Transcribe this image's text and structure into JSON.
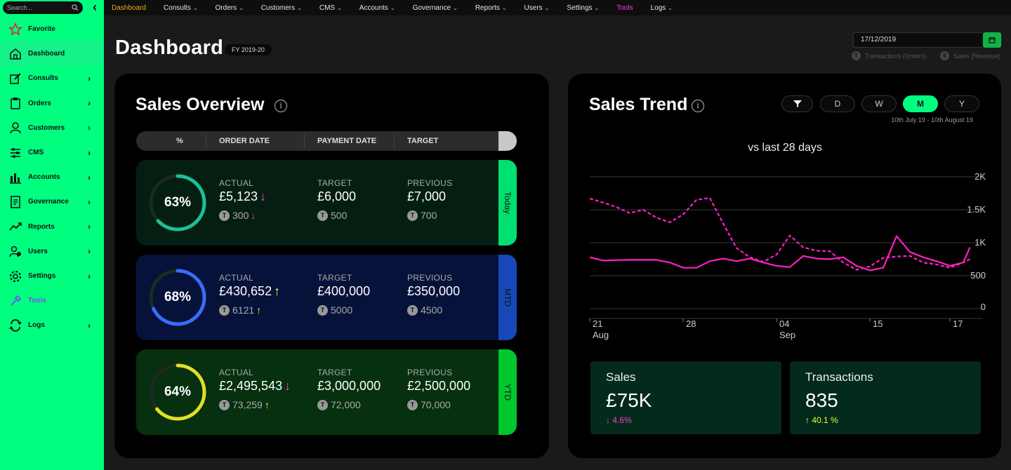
{
  "sidebar": {
    "search_placeholder": "Search...",
    "items": [
      {
        "label": "Favorite",
        "icon": "star-icon",
        "chevron": false
      },
      {
        "label": "Dashboard",
        "icon": "home-icon",
        "chevron": false
      },
      {
        "label": "Consults",
        "icon": "edit-icon",
        "chevron": true
      },
      {
        "label": "Orders",
        "icon": "clipboard-icon",
        "chevron": true
      },
      {
        "label": "Customers",
        "icon": "user-icon",
        "chevron": true
      },
      {
        "label": "CMS",
        "icon": "sliders-icon",
        "chevron": true
      },
      {
        "label": "Accounts",
        "icon": "bar-chart-icon",
        "chevron": true
      },
      {
        "label": "Governance",
        "icon": "document-icon",
        "chevron": true
      },
      {
        "label": "Reports",
        "icon": "trend-icon",
        "chevron": true
      },
      {
        "label": "Users",
        "icon": "users-icon",
        "chevron": true
      },
      {
        "label": "Settings",
        "icon": "gear-icon",
        "chevron": true
      },
      {
        "label": "Tools",
        "icon": "tools-icon",
        "chevron": false
      },
      {
        "label": "Logs",
        "icon": "sync-icon",
        "chevron": true
      }
    ]
  },
  "topnav": [
    {
      "label": "Dashboard",
      "dropdown": false
    },
    {
      "label": "Consults",
      "dropdown": true
    },
    {
      "label": "Orders",
      "dropdown": true
    },
    {
      "label": "Customers",
      "dropdown": true
    },
    {
      "label": "CMS",
      "dropdown": true
    },
    {
      "label": "Accounts",
      "dropdown": true
    },
    {
      "label": "Governance",
      "dropdown": true
    },
    {
      "label": "Reports",
      "dropdown": true
    },
    {
      "label": "Users",
      "dropdown": true
    },
    {
      "label": "Settings",
      "dropdown": true
    },
    {
      "label": "Tools",
      "dropdown": false
    },
    {
      "label": "Logs",
      "dropdown": true
    }
  ],
  "header": {
    "title": "Dashboard",
    "fy": "FY 2019-20",
    "date": "17/12/2019",
    "legend_t": "Transactions (Orders)",
    "legend_s": "Sales (Revenue)"
  },
  "overview": {
    "title": "Sales Overview",
    "columns": [
      "%",
      "ORDER DATE",
      "PAYMENT DATE",
      "TARGET"
    ],
    "rows": [
      {
        "period": "Today",
        "pct": "63%",
        "progress": 0.63,
        "ring_color": "#17c29a",
        "bg": "#041f12",
        "tab_color": "#00e070",
        "actual": "£5,123",
        "actual_dir": "down",
        "actual_t": "300",
        "actual_t_dir": "down",
        "target": "£6,000",
        "target_t": "500",
        "previous": "£7,000",
        "previous_t": "700"
      },
      {
        "period": "MTD",
        "pct": "68%",
        "progress": 0.68,
        "ring_color": "#3a6cff",
        "bg": "#06123a",
        "tab_color": "#1748b8",
        "actual": "£430,652",
        "actual_dir": "up",
        "actual_t": "6121",
        "actual_t_dir": "up",
        "target": "£400,000",
        "target_t": "5000",
        "previous": "£350,000",
        "previous_t": "4500"
      },
      {
        "period": "YTD",
        "pct": "64%",
        "progress": 0.64,
        "ring_color": "#e0e024",
        "bg": "#06300f",
        "tab_color": "#00c72e",
        "actual": "£2,495,543",
        "actual_dir": "down",
        "actual_t": "73,259",
        "actual_t_dir": "up",
        "target": "£3,000,000",
        "target_t": "72,000",
        "previous": "£2,500,000",
        "previous_t": "70,000"
      }
    ],
    "cap_actual": "ACTUAL",
    "cap_target": "TARGET",
    "cap_previous": "PREVIOUS",
    "t_badge": "T"
  },
  "trend": {
    "title": "Sales Trend",
    "periods": [
      "D",
      "W",
      "M",
      "Y"
    ],
    "active_period": "M",
    "range": "10th July 19 - 10th August 19",
    "subtitle": "vs last 28 days",
    "sales_label": "Sales",
    "sales_value": "£75K",
    "sales_change": "4.6%",
    "tx_label": "Transactions",
    "tx_value": "835",
    "tx_change": "40.1 %"
  },
  "chart_data": {
    "type": "line",
    "title": "vs last 28 days",
    "ylim": [
      0,
      2000
    ],
    "yticks": [
      "2K",
      "1.5K",
      "1K",
      "500",
      "0"
    ],
    "ytick_values": [
      2000,
      1500,
      1000,
      500,
      0
    ],
    "xticks": [
      {
        "day": "21",
        "month": "Aug",
        "x": 0
      },
      {
        "day": "28",
        "month": "",
        "x": 7
      },
      {
        "day": "04",
        "month": "Sep",
        "x": 14
      },
      {
        "day": "15",
        "month": "",
        "x": 21
      },
      {
        "day": "17",
        "month": "",
        "x": 27
      }
    ],
    "xlim": [
      0,
      28
    ],
    "series": [
      {
        "style": "solid",
        "color": "#ff1fc4",
        "values": [
          [
            0,
            780
          ],
          [
            1,
            730
          ],
          [
            3,
            740
          ],
          [
            5,
            740
          ],
          [
            6,
            700
          ],
          [
            7,
            620
          ],
          [
            8,
            620
          ],
          [
            9,
            720
          ],
          [
            10,
            760
          ],
          [
            11,
            720
          ],
          [
            12,
            760
          ],
          [
            13,
            700
          ],
          [
            14,
            650
          ],
          [
            15,
            630
          ],
          [
            16,
            800
          ],
          [
            17,
            760
          ],
          [
            18,
            750
          ],
          [
            19,
            780
          ],
          [
            20,
            650
          ],
          [
            21,
            580
          ],
          [
            22,
            620
          ],
          [
            23,
            1100
          ],
          [
            24,
            860
          ],
          [
            25,
            780
          ],
          [
            26,
            720
          ],
          [
            27,
            650
          ],
          [
            28,
            700
          ],
          [
            28.5,
            930
          ]
        ]
      },
      {
        "style": "dashed",
        "color": "#ff1fc4",
        "values": [
          [
            0,
            1670
          ],
          [
            1,
            1610
          ],
          [
            2,
            1540
          ],
          [
            3,
            1450
          ],
          [
            4,
            1500
          ],
          [
            5,
            1380
          ],
          [
            6,
            1310
          ],
          [
            7,
            1430
          ],
          [
            8,
            1650
          ],
          [
            9,
            1680
          ],
          [
            10,
            1290
          ],
          [
            11,
            920
          ],
          [
            12,
            780
          ],
          [
            13,
            710
          ],
          [
            14,
            820
          ],
          [
            15,
            1110
          ],
          [
            16,
            930
          ],
          [
            17,
            880
          ],
          [
            18,
            870
          ],
          [
            19,
            700
          ],
          [
            20,
            590
          ],
          [
            21,
            640
          ],
          [
            22,
            770
          ],
          [
            23,
            790
          ],
          [
            24,
            800
          ],
          [
            25,
            700
          ],
          [
            26,
            670
          ],
          [
            27,
            620
          ],
          [
            28,
            700
          ],
          [
            28.5,
            750
          ]
        ]
      }
    ]
  }
}
